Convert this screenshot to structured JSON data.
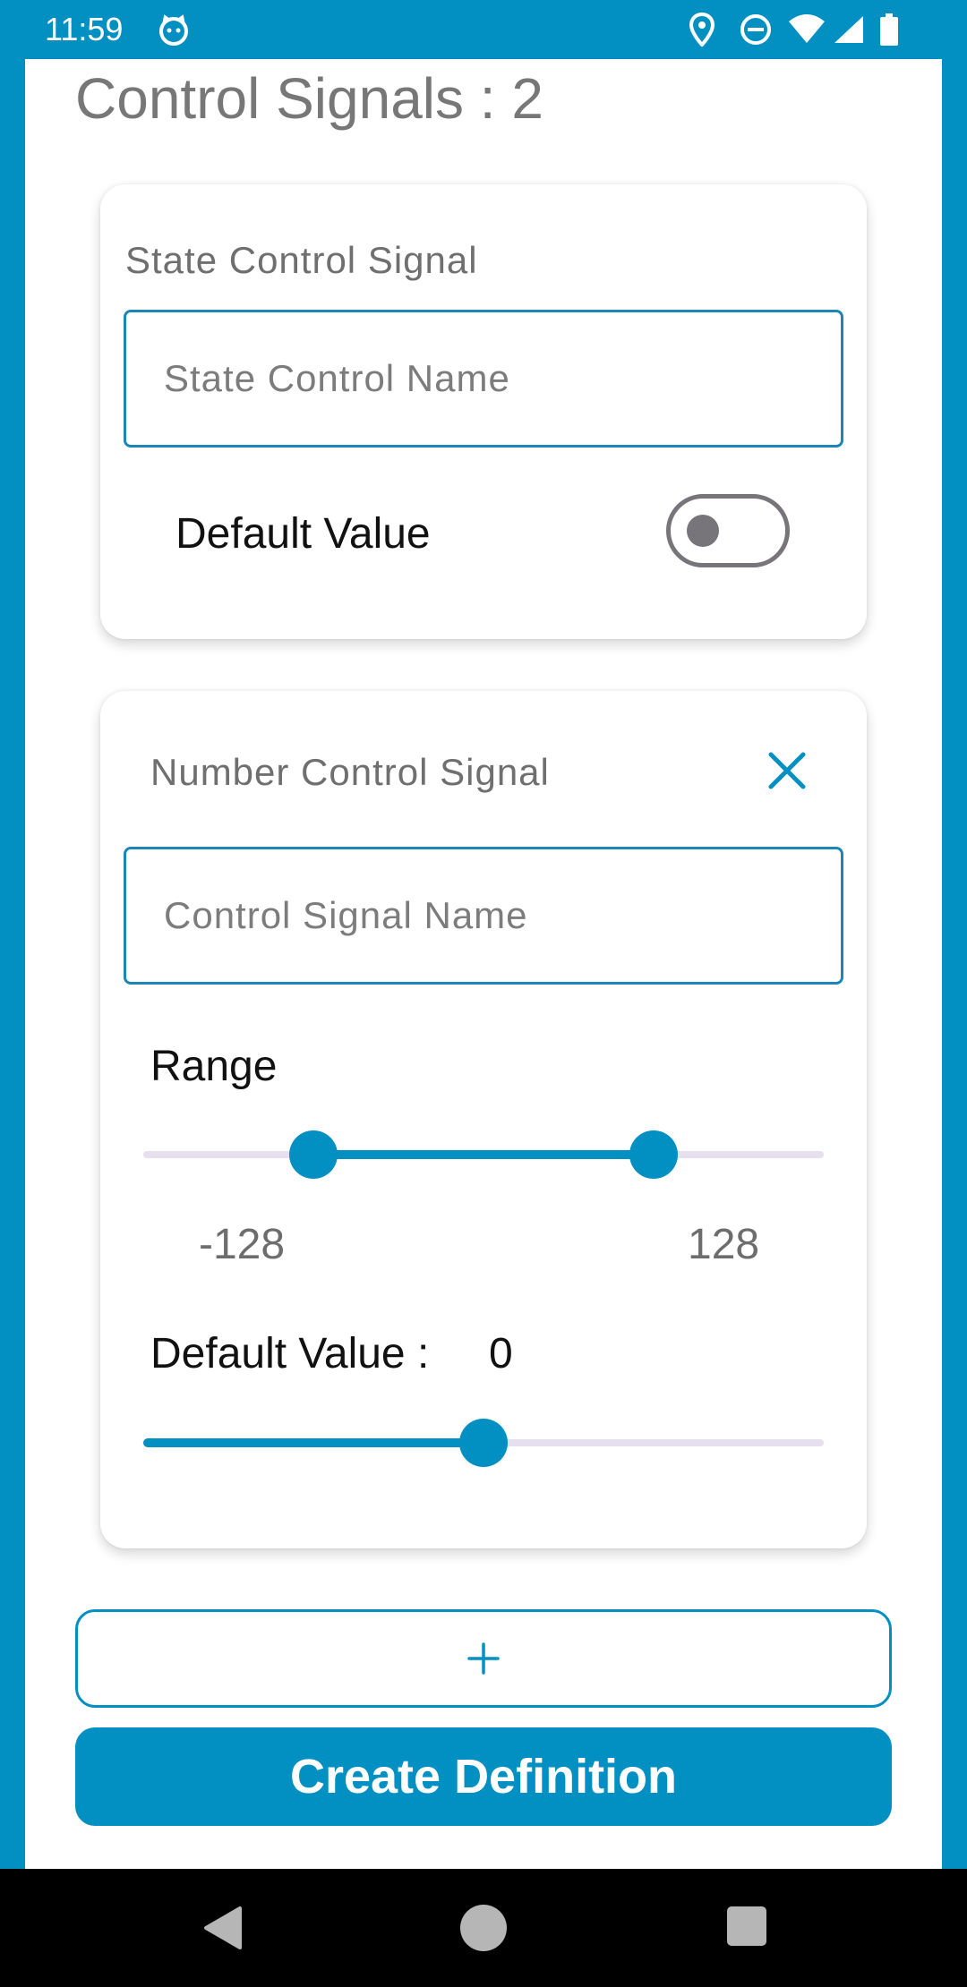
{
  "status_bar": {
    "time": "11:59",
    "icons": [
      "cat-icon",
      "location-icon",
      "dnd-icon",
      "wifi-icon",
      "signal-icon",
      "battery-icon"
    ]
  },
  "page": {
    "title": "Control Signals : 2"
  },
  "state_card": {
    "label": "State Control Signal",
    "name_placeholder": "State Control Name",
    "name_value": "",
    "default_value_label": "Default Value",
    "toggle_on": false
  },
  "number_card": {
    "label": "Number Control Signal",
    "close_icon": "close-icon",
    "name_placeholder": "Control Signal Name",
    "name_value": "",
    "range_label": "Range",
    "range_min": "-128",
    "range_max": "128",
    "range_low_fraction": 0.25,
    "range_high_fraction": 0.75,
    "default_value_label": "Default Value :",
    "default_value": "0",
    "default_fraction": 0.5
  },
  "actions": {
    "add_icon": "plus-icon",
    "create_label": "Create Definition"
  },
  "nav_bar": {
    "icons": [
      "back-icon",
      "home-icon",
      "recents-icon"
    ]
  },
  "colors": {
    "accent": "#0290c2",
    "track_inactive": "#e6e0ee",
    "toggle_off": "#77747a"
  }
}
